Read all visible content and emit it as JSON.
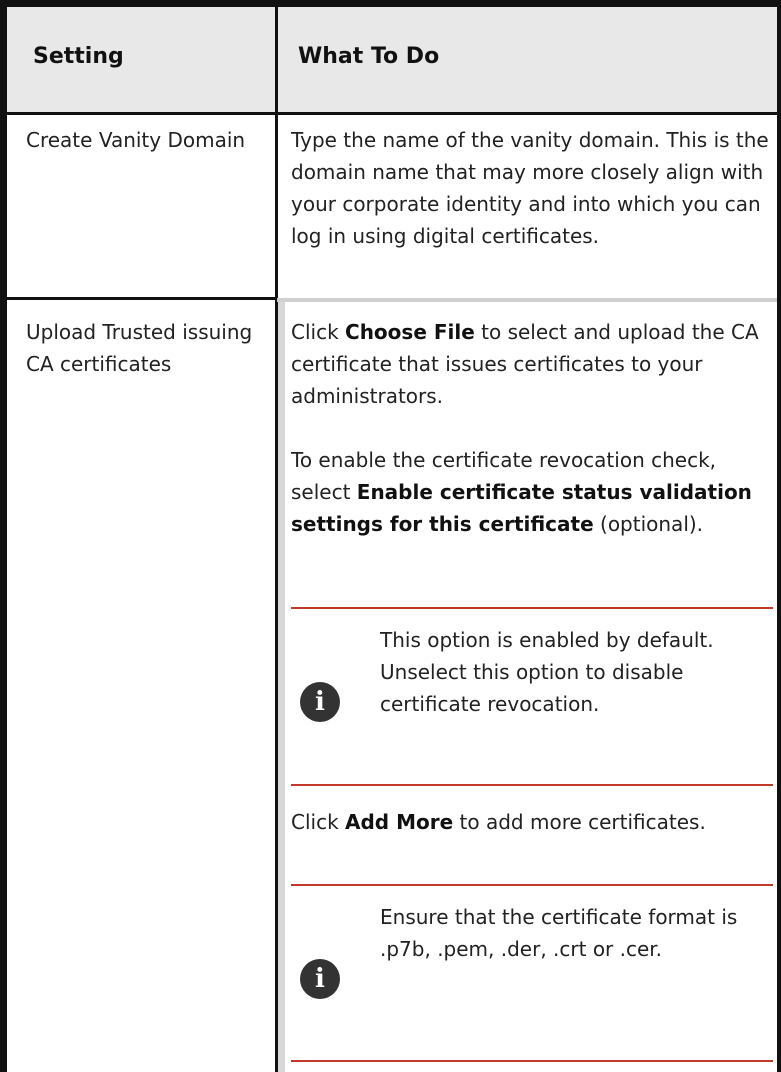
{
  "table": {
    "headers": {
      "setting": "Setting",
      "what_to_do": "What To Do"
    },
    "row1": {
      "setting": "Create Vanity Domain",
      "what_to_do": "Type the name of the vanity domain. This is the domain name that may more closely align with your corporate identity and into which you can log in using digital certificates."
    },
    "row2": {
      "setting": "Upload Trusted issuing CA certificates",
      "para1": {
        "pre": "Click ",
        "bold": "Choose File",
        "post": " to select and upload the CA certificate that issues certificates to your administrators."
      },
      "para2": {
        "pre": "To enable the certificate revocation check, select ",
        "bold": "Enable certificate status validation settings for this certificate",
        "post": " (optional)."
      },
      "note1": {
        "icon": "info-icon",
        "text": "This option is enabled by default. Unselect this option to disable certificate revocation."
      },
      "para3": {
        "pre": "Click ",
        "bold": "Add More",
        "post": " to add more certificates."
      },
      "note2": {
        "icon": "info-icon",
        "text": "Ensure that the certificate format is .p7b, .pem, .der, .crt or .cer."
      }
    }
  },
  "colors": {
    "header_bg": "#e8e8e8",
    "note_rule": "#c0392b",
    "border": "#111111"
  }
}
